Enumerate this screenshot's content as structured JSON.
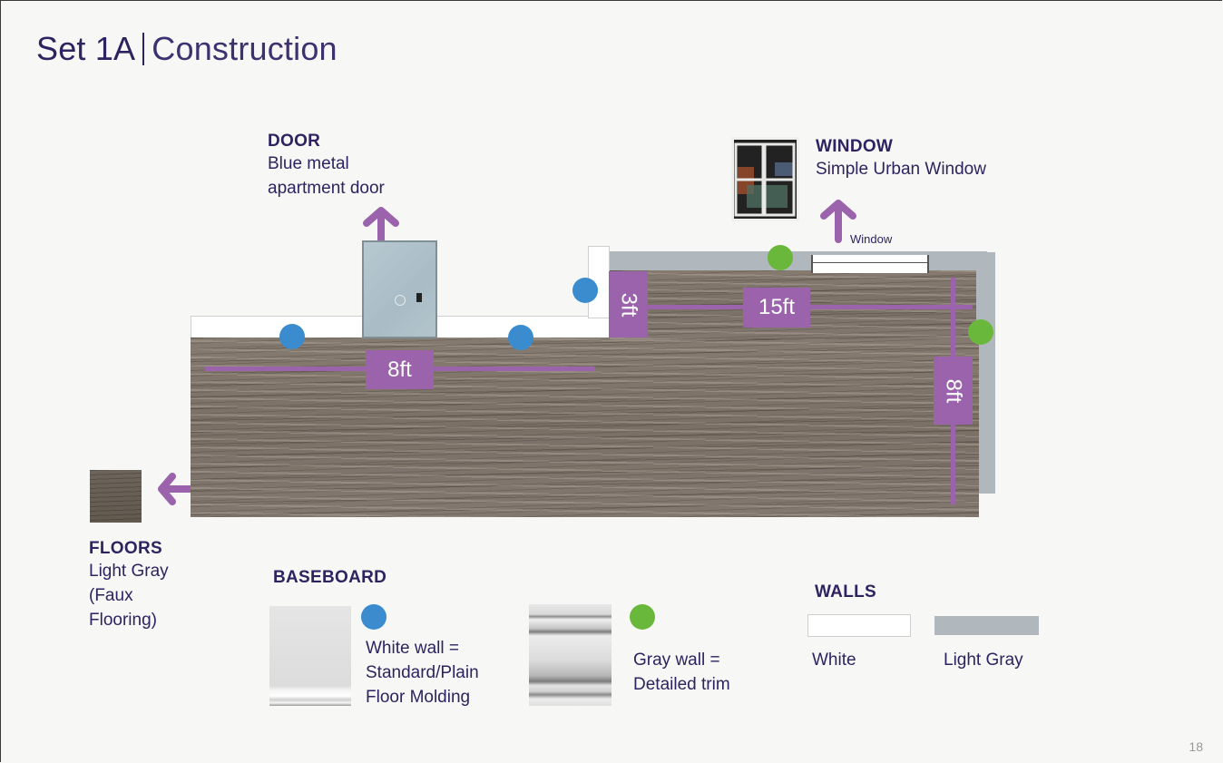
{
  "slide": {
    "title_main": "Set 1A",
    "title_sub": "Construction",
    "page_number": "18"
  },
  "callouts": {
    "door": {
      "heading": "DOOR",
      "line1": "Blue metal",
      "line2": "apartment door"
    },
    "window": {
      "heading": "WINDOW",
      "line1": "Simple Urban Window",
      "small_label": "Window"
    },
    "floors": {
      "heading": "FLOORS",
      "line1": "Light Gray",
      "line2": "(Faux",
      "line3": "Flooring)"
    }
  },
  "dimensions": {
    "front_wall": "8ft",
    "short_wall": "3ft",
    "back_wall": "15ft",
    "side_wall": "8ft"
  },
  "legend": {
    "baseboard": {
      "heading": "BASEBOARD",
      "white": {
        "line1": "White wall =",
        "line2": "Standard/Plain",
        "line3": "Floor Molding",
        "marker_color": "#3a8ccf"
      },
      "gray": {
        "line1": "Gray wall =",
        "line2": "Detailed trim",
        "marker_color": "#6ab83b"
      }
    },
    "walls": {
      "heading": "WALLS",
      "white": {
        "label": "White",
        "color": "#ffffff"
      },
      "gray": {
        "label": "Light Gray",
        "color": "#b1b8bd"
      }
    }
  },
  "colors": {
    "accent_purple": "#9a63ab",
    "text_navy": "#2e2360",
    "marker_blue": "#3a8ccf",
    "marker_green": "#6ab83b"
  }
}
